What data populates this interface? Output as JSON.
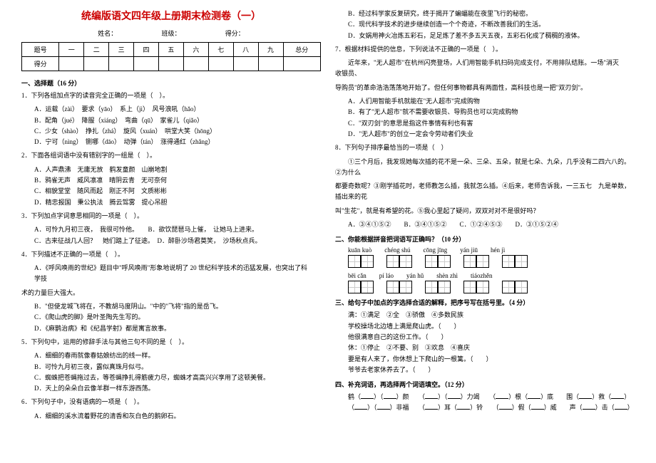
{
  "title": "统编版语文四年级上册期末检测卷（一）",
  "meta": {
    "name": "姓名：",
    "class": "班级：",
    "score": "得分："
  },
  "score_table": {
    "head": [
      "题号",
      "一",
      "二",
      "三",
      "四",
      "五",
      "六",
      "七",
      "八",
      "九",
      "总分"
    ],
    "row": "得分"
  },
  "s1": {
    "head": "一、选择题（16 分）",
    "q1": "1．下列各组加点字的读音完全正确的一项是（　）。",
    "q1o": [
      "A．运载（zài）　要求（yāo）　系上（jì）　风号浪吼（hǎo）",
      "B．配角（jué）　降服（xiáng）　弯曲（qū）　家雀儿（qiǎo）",
      "C．少女（shào）　挣扎（zhá）　旋风（xuán）　哄堂大笑（hōng）",
      "D．宁可（nìng）　铡哪（dāo）　动弹（tán）　涨得通红（zhǎng）"
    ],
    "q2": "2．下面各组词语中没有错别字的一组是（　）。",
    "q2o": [
      "A．人声鼎沸　无庸无放　鹤发童颜　山崩地割",
      "B．鸦雀无声　威风凛凛　晴阴云青　无可奈何",
      "C．相貌堂堂　随风而起　刚正不阿　文质彬彬",
      "D．精忠报国　秉公执法　腾云驾雾　提心吊胆"
    ],
    "q3": "3．下列加点字词意思相同的一项是（　）。",
    "q3o": [
      "A．可怜九月初三夜，　我很可怜他。　　B．欲饮琵琶马上催，　让她马上进来。",
      "C．古来征战几人回？　她们踏上了征途。　D．醉卧沙场君莫笑，　沙场秋点兵。"
    ],
    "q4": "4．下列描述不正确的一项是（　）。",
    "q4a": "A．《呼风唤雨的世纪》题目中\"呼风唤雨\"形象地说明了 20 世纪科学技术的迅猛发展，也突出了科　　学技",
    "q4a2": "术的力量巨大强大。",
    "q4o": [
      "B．\"但使龙城飞将在，不教胡马度阴山。\"中的\"飞将\"指的是岳飞。",
      "C．《爬山虎的脚》是叶圣陶先生写的。",
      "D．《麻鹊治病》和《纪昌学射》都是寓言故事。"
    ],
    "q5": "5．下列句中，运用的修辞手法与其他三句不同的是（　）。",
    "q5o": [
      "A．细细的春雨就像春姑娘纺出的线一样。",
      "B．可怜九月初三夜，露似真珠月似弓。",
      "C．蜘蛛把苍蝇拖过去，等苍蝇挣扎得筋疲力尽，蜘蛛才高高兴兴享用了这顿美餐。",
      "D．天上的朵朵白云像羊群一样东游西荡。"
    ],
    "q6": "6．下列句子中，没有语病的一项是（　）。",
    "q6o": [
      "A．细细的溪水流着野花的清香和灰白色的鹅卵石。"
    ]
  },
  "r": {
    "q6b": "B．经过科学家反复研究，终于揭开了蝙蝠能在夜里飞行的秘密。",
    "q6c": "C．现代科学技术的进步继续创造一个个奇迹，不断改善我们的生活。",
    "q6d": "D．女娲用神火冶炼五彩石，足足炼了差不多五天五夜，五彩石化成了稠稠的液体。",
    "q7": "7．根据材料提供的信息，下列说法不正确的一项是（　）。",
    "q7p1": "近年来，\"无人超市\"在杭州闪亮登场，人们用智能手机扫码完成支付，不用排队结账。一场\"消灭　　收银员、",
    "q7p2": "导购员\"的革命浩浩荡荡地开始了。但任何事物都具有两面性，高科技也是一把\"双刃剑\"。",
    "q7o": [
      "A．人们用智能手机就能在\"无人超市\"完成购物",
      "B．有了\"无人超市\"就不需要收银员、导购员也可以完成购物",
      "C．\"双刃剑\"的意思是指这件事情有利也有害",
      "D．\"无人超市\"的创立一定会令劳动者们失业"
    ],
    "q8": "8．下列句子排序最恰当的一项是（　）",
    "q8p1": "①三个月后，我发现她每次插的花不是一朵、三朵、五朵，就是七朵、九朵，几乎没有二四六八的。　②为什么",
    "q8p2": "都要奇数呢？③刚学插花时，老师教怎么插，我就怎么插。④后来，老师告诉我，一三五七　九是单数，插出来的花",
    "q8p3": "叫\"生花\"，就是有希望的花。⑤我心里起了疑问，双双对对不是很好吗？",
    "q8o": "A．③④①⑤②　　B．③④①⑤②　　C．①②④⑤③　　D．③①⑤②④",
    "s2": "二、你能根据拼音把词语写正确吗？（10 分）",
    "p1": [
      "kuān kuò",
      "chéng shú",
      "cōng jīng",
      "yán jiū",
      "hén jì"
    ],
    "p2": [
      "bēi cǎn",
      "pí láo",
      "yán hǔ",
      "shèn zhì",
      "tiáozhěn"
    ],
    "s3": "三、给句子中加点的字选择合适的解释，把序号写在括号里。（4 分）",
    "s3d": "满：①满足　②全　③骄傲　④多数民族",
    "s3l": [
      "学校操场北边墙上满是爬山虎。（　　）",
      "他很满意自己的这份工作。（　　）",
      "休：①停止　②不要、别　③欢息　④喜庆",
      "要是有人来了，你休想上下爬山的一根篱。（　　）",
      "爷爷去老家休养去了。（　　）"
    ],
    "s4": "四、补充词语，再选择两个词语填空。（12 分）"
  }
}
